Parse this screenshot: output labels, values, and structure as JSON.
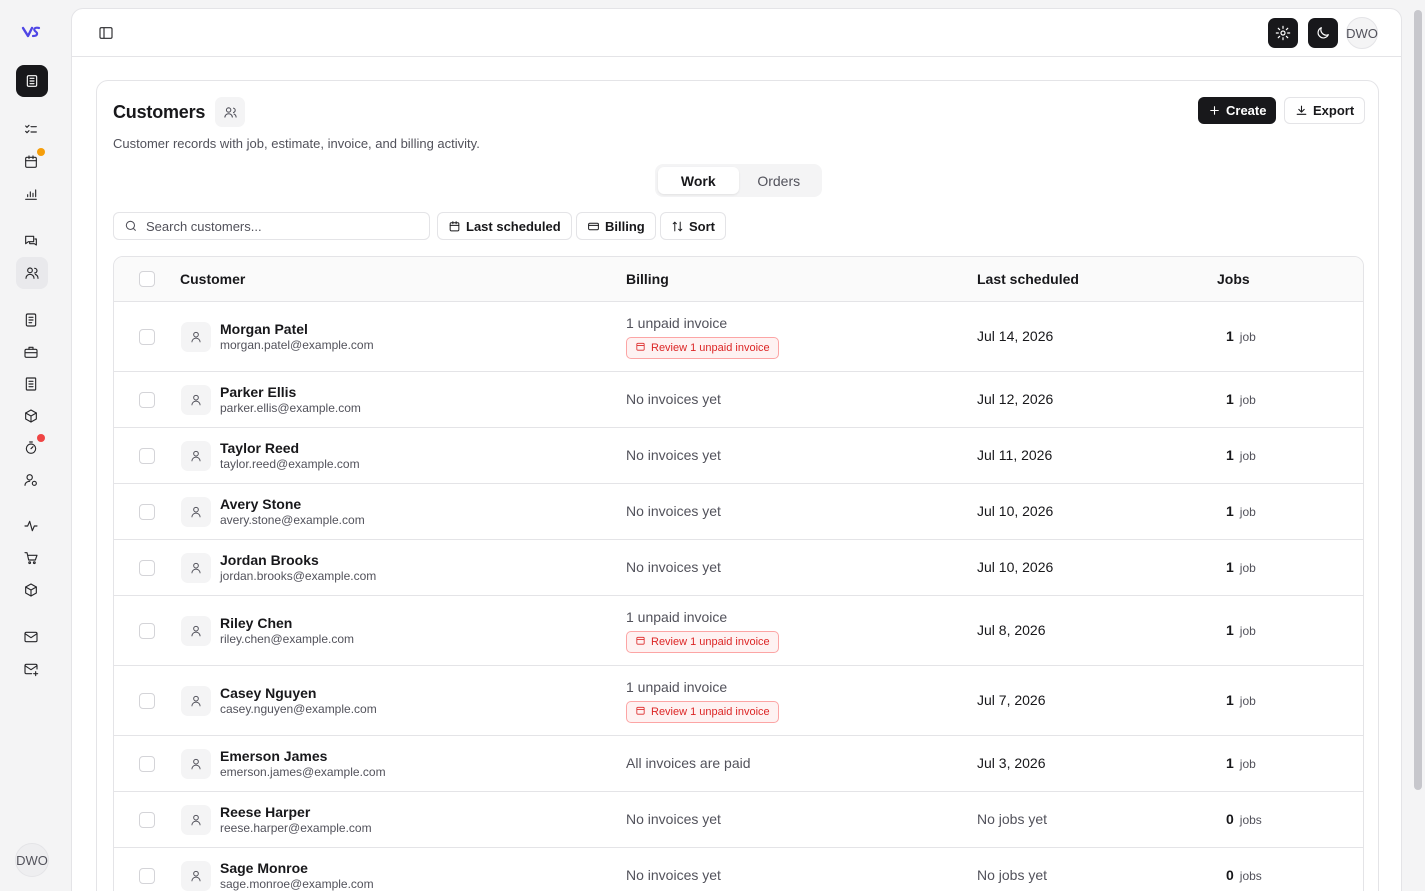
{
  "rail": {
    "avatar": "DWO",
    "colors": {
      "orange_dot": "#f59e0b",
      "red_dot": "#ef4444"
    }
  },
  "topbar": {
    "avatar": "DWO"
  },
  "page": {
    "title": "Customers",
    "subtitle": "Customer records with job, estimate, invoice, and billing activity.",
    "create_label": "Create",
    "export_label": "Export",
    "tabs": [
      {
        "label": "Work",
        "active": true
      },
      {
        "label": "Orders",
        "active": false
      }
    ],
    "search_placeholder": "Search customers...",
    "filters": {
      "last_scheduled": "Last scheduled",
      "billing": "Billing",
      "sort": "Sort"
    }
  },
  "table": {
    "headers": {
      "customer": "Customer",
      "billing": "Billing",
      "last_scheduled": "Last scheduled",
      "jobs": "Jobs"
    },
    "rows": [
      {
        "name": "Morgan Patel",
        "email": "morgan.patel@example.com",
        "billing": "1 unpaid invoice",
        "badge": "Review 1 unpaid invoice",
        "date": "Jul 14, 2026",
        "jobs": "1",
        "jobs_unit": "job"
      },
      {
        "name": "Parker Ellis",
        "email": "parker.ellis@example.com",
        "billing": "No invoices yet",
        "badge": "",
        "date": "Jul 12, 2026",
        "jobs": "1",
        "jobs_unit": "job"
      },
      {
        "name": "Taylor Reed",
        "email": "taylor.reed@example.com",
        "billing": "No invoices yet",
        "badge": "",
        "date": "Jul 11, 2026",
        "jobs": "1",
        "jobs_unit": "job"
      },
      {
        "name": "Avery Stone",
        "email": "avery.stone@example.com",
        "billing": "No invoices yet",
        "badge": "",
        "date": "Jul 10, 2026",
        "jobs": "1",
        "jobs_unit": "job"
      },
      {
        "name": "Jordan Brooks",
        "email": "jordan.brooks@example.com",
        "billing": "No invoices yet",
        "badge": "",
        "date": "Jul 10, 2026",
        "jobs": "1",
        "jobs_unit": "job"
      },
      {
        "name": "Riley Chen",
        "email": "riley.chen@example.com",
        "billing": "1 unpaid invoice",
        "badge": "Review 1 unpaid invoice",
        "date": "Jul 8, 2026",
        "jobs": "1",
        "jobs_unit": "job"
      },
      {
        "name": "Casey Nguyen",
        "email": "casey.nguyen@example.com",
        "billing": "1 unpaid invoice",
        "badge": "Review 1 unpaid invoice",
        "date": "Jul 7, 2026",
        "jobs": "1",
        "jobs_unit": "job"
      },
      {
        "name": "Emerson James",
        "email": "emerson.james@example.com",
        "billing": "All invoices are paid",
        "badge": "",
        "date": "Jul 3, 2026",
        "jobs": "1",
        "jobs_unit": "job"
      },
      {
        "name": "Reese Harper",
        "email": "reese.harper@example.com",
        "billing": "No invoices yet",
        "badge": "",
        "date": "No jobs yet",
        "jobs": "0",
        "jobs_unit": "jobs"
      },
      {
        "name": "Sage Monroe",
        "email": "sage.monroe@example.com",
        "billing": "No invoices yet",
        "badge": "",
        "date": "No jobs yet",
        "jobs": "0",
        "jobs_unit": "jobs"
      }
    ]
  }
}
